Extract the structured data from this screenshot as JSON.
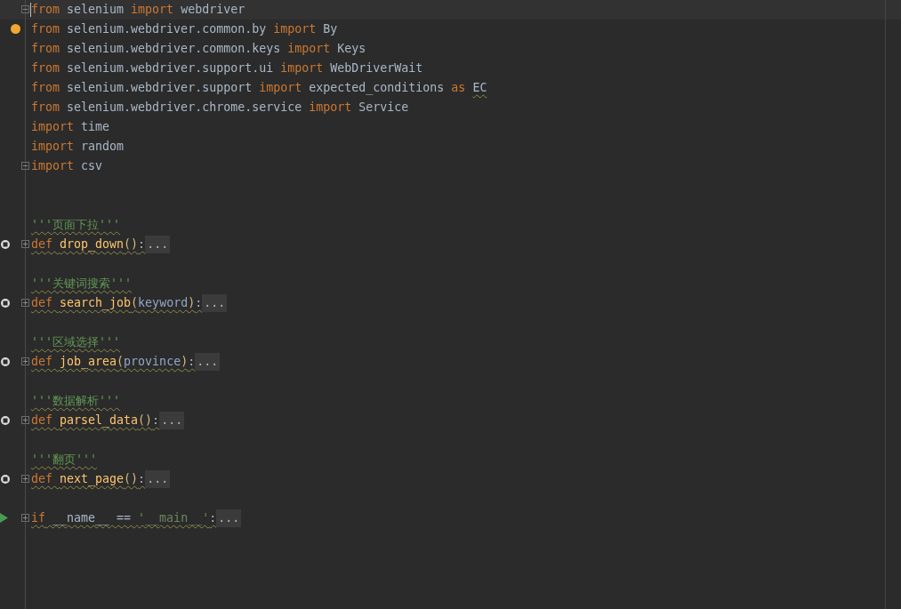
{
  "editor": {
    "lines": [
      {
        "kind": "code",
        "current": true,
        "bulb": false,
        "fold": {
          "kind": "start"
        },
        "tokens": [
          {
            "t": "from",
            "kind": "keyword",
            "warn": false
          },
          {
            "t": " selenium ",
            "kind": "plain",
            "warn": false
          },
          {
            "t": "import",
            "kind": "keyword",
            "warn": false
          },
          {
            "t": " webdriver",
            "kind": "plain",
            "warn": false
          }
        ]
      },
      {
        "kind": "code",
        "current": false,
        "bulb": true,
        "tokens": [
          {
            "t": "from",
            "kind": "keyword",
            "warn": false
          },
          {
            "t": " selenium.webdriver.common.by ",
            "kind": "plain",
            "warn": false
          },
          {
            "t": "import",
            "kind": "keyword",
            "warn": false
          },
          {
            "t": " By",
            "kind": "plain",
            "warn": false
          }
        ]
      },
      {
        "kind": "code",
        "current": false,
        "bulb": false,
        "tokens": [
          {
            "t": "from",
            "kind": "keyword",
            "warn": false
          },
          {
            "t": " selenium.webdriver.common.keys ",
            "kind": "plain",
            "warn": false
          },
          {
            "t": "import",
            "kind": "keyword",
            "warn": false
          },
          {
            "t": " Keys",
            "kind": "plain",
            "warn": false
          }
        ]
      },
      {
        "kind": "code",
        "current": false,
        "bulb": false,
        "tokens": [
          {
            "t": "from",
            "kind": "keyword",
            "warn": false
          },
          {
            "t": " selenium.webdriver.support.ui ",
            "kind": "plain",
            "warn": false
          },
          {
            "t": "import",
            "kind": "keyword",
            "warn": false
          },
          {
            "t": " WebDriverWait",
            "kind": "plain",
            "warn": false
          }
        ]
      },
      {
        "kind": "code",
        "current": false,
        "bulb": false,
        "tokens": [
          {
            "t": "from",
            "kind": "keyword",
            "warn": false
          },
          {
            "t": " selenium.webdriver.support ",
            "kind": "plain",
            "warn": false
          },
          {
            "t": "import",
            "kind": "keyword",
            "warn": false
          },
          {
            "t": " expected_conditions ",
            "kind": "plain",
            "warn": false
          },
          {
            "t": "as ",
            "kind": "keyword",
            "warn": false
          },
          {
            "t": "EC",
            "kind": "plain",
            "warn": true
          }
        ]
      },
      {
        "kind": "code",
        "current": false,
        "bulb": false,
        "tokens": [
          {
            "t": "from",
            "kind": "keyword",
            "warn": false
          },
          {
            "t": " selenium.webdriver.chrome.service ",
            "kind": "plain",
            "warn": false
          },
          {
            "t": "import",
            "kind": "keyword",
            "warn": false
          },
          {
            "t": " Service",
            "kind": "plain",
            "warn": false
          }
        ]
      },
      {
        "kind": "code",
        "current": false,
        "bulb": false,
        "tokens": [
          {
            "t": "import",
            "kind": "keyword",
            "warn": false
          },
          {
            "t": " time",
            "kind": "plain",
            "warn": false
          }
        ]
      },
      {
        "kind": "code",
        "current": false,
        "bulb": false,
        "tokens": [
          {
            "t": "import",
            "kind": "keyword",
            "warn": false
          },
          {
            "t": " random",
            "kind": "plain",
            "warn": false
          }
        ]
      },
      {
        "kind": "code",
        "current": false,
        "bulb": false,
        "fold": {
          "kind": "end"
        },
        "tokens": [
          {
            "t": "import",
            "kind": "keyword",
            "warn": false
          },
          {
            "t": " csv",
            "kind": "plain",
            "warn": false
          }
        ]
      },
      {
        "kind": "blank"
      },
      {
        "kind": "blank"
      },
      {
        "kind": "code",
        "current": false,
        "bulb": false,
        "tokens": [
          {
            "t": "'''页面下拉'''",
            "kind": "docstring",
            "warn": true
          }
        ]
      },
      {
        "kind": "code",
        "current": false,
        "bulb": false,
        "marker": {
          "kind": "method"
        },
        "fold": {
          "kind": "collapsed"
        },
        "tokens": [
          {
            "t": "def ",
            "kind": "keyword",
            "warn": true
          },
          {
            "t": "drop_down",
            "kind": "func",
            "warn": true
          },
          {
            "t": "()",
            "kind": "paren",
            "warn": true
          },
          {
            "t": ":",
            "kind": "plain",
            "warn": true
          },
          {
            "t": "...",
            "kind": "folded",
            "warn": false
          }
        ]
      },
      {
        "kind": "blank"
      },
      {
        "kind": "code",
        "current": false,
        "bulb": false,
        "tokens": [
          {
            "t": "'''关键词搜索'''",
            "kind": "docstring",
            "warn": true
          }
        ]
      },
      {
        "kind": "code",
        "current": false,
        "bulb": false,
        "marker": {
          "kind": "method"
        },
        "fold": {
          "kind": "collapsed"
        },
        "tokens": [
          {
            "t": "def ",
            "kind": "keyword",
            "warn": true
          },
          {
            "t": "search_job",
            "kind": "func",
            "warn": true
          },
          {
            "t": "(",
            "kind": "paren",
            "warn": true
          },
          {
            "t": "keyword",
            "kind": "param",
            "warn": true
          },
          {
            "t": ")",
            "kind": "paren",
            "warn": true
          },
          {
            "t": ":",
            "kind": "plain",
            "warn": true
          },
          {
            "t": "...",
            "kind": "folded",
            "warn": false
          }
        ]
      },
      {
        "kind": "blank"
      },
      {
        "kind": "code",
        "current": false,
        "bulb": false,
        "tokens": [
          {
            "t": "'''区域选择'''",
            "kind": "docstring",
            "warn": true
          }
        ]
      },
      {
        "kind": "code",
        "current": false,
        "bulb": false,
        "marker": {
          "kind": "method"
        },
        "fold": {
          "kind": "collapsed"
        },
        "tokens": [
          {
            "t": "def ",
            "kind": "keyword",
            "warn": true
          },
          {
            "t": "job_area",
            "kind": "func",
            "warn": true
          },
          {
            "t": "(",
            "kind": "paren",
            "warn": true
          },
          {
            "t": "province",
            "kind": "param",
            "warn": true
          },
          {
            "t": ")",
            "kind": "paren",
            "warn": true
          },
          {
            "t": ":",
            "kind": "plain",
            "warn": true
          },
          {
            "t": "...",
            "kind": "folded",
            "warn": false
          }
        ]
      },
      {
        "kind": "blank"
      },
      {
        "kind": "code",
        "current": false,
        "bulb": false,
        "tokens": [
          {
            "t": "'''数据解析'''",
            "kind": "docstring",
            "warn": true
          }
        ]
      },
      {
        "kind": "code",
        "current": false,
        "bulb": false,
        "marker": {
          "kind": "method"
        },
        "fold": {
          "kind": "collapsed"
        },
        "tokens": [
          {
            "t": "def ",
            "kind": "keyword",
            "warn": true
          },
          {
            "t": "parsel_data",
            "kind": "func",
            "warn": true
          },
          {
            "t": "()",
            "kind": "paren",
            "warn": true
          },
          {
            "t": ":",
            "kind": "plain",
            "warn": true
          },
          {
            "t": "...",
            "kind": "folded",
            "warn": false
          }
        ]
      },
      {
        "kind": "blank"
      },
      {
        "kind": "code",
        "current": false,
        "bulb": false,
        "tokens": [
          {
            "t": "'''翻页'''",
            "kind": "docstring",
            "warn": true
          }
        ]
      },
      {
        "kind": "code",
        "current": false,
        "bulb": false,
        "marker": {
          "kind": "method"
        },
        "fold": {
          "kind": "collapsed"
        },
        "tokens": [
          {
            "t": "def ",
            "kind": "keyword",
            "warn": true
          },
          {
            "t": "next_page",
            "kind": "func",
            "warn": true
          },
          {
            "t": "()",
            "kind": "paren",
            "warn": true
          },
          {
            "t": ":",
            "kind": "plain",
            "warn": true
          },
          {
            "t": "...",
            "kind": "folded",
            "warn": false
          }
        ]
      },
      {
        "kind": "blank"
      },
      {
        "kind": "code",
        "current": false,
        "bulb": false,
        "marker": {
          "kind": "run"
        },
        "fold": {
          "kind": "collapsed"
        },
        "tokens": [
          {
            "t": "if",
            "kind": "keyword",
            "warn": true
          },
          {
            "t": " __name__ == ",
            "kind": "plain",
            "warn": true
          },
          {
            "t": "'__main__'",
            "kind": "string",
            "warn": true
          },
          {
            "t": ":",
            "kind": "plain",
            "warn": true
          },
          {
            "t": "...",
            "kind": "folded",
            "warn": false
          }
        ]
      }
    ]
  }
}
